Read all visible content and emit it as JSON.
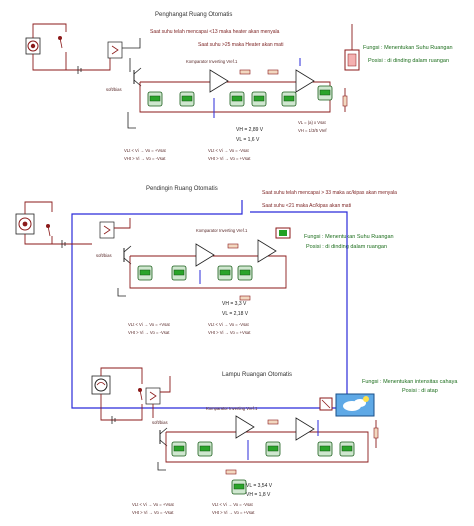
{
  "sections": [
    {
      "title": "Penghangat Ruang Otomatis",
      "notes": [
        "Saat suhu  telah mencapai  <13 maka heater akan menyala",
        "Saat suhu >25 maka Heater akan mati"
      ],
      "function_label": "Fungsi : Menentukan Suhu Ruangan",
      "position_label": "Posisi : di dinding dalam ruangan",
      "comparator_label": "Komparator Inverting Vref.1",
      "relay_label": "soft/bias",
      "readings": [
        "VH = 2,89 V",
        "VL = 1,6 V"
      ],
      "rules_left": [
        "VLt < Vi  →  Vo = +Vsat",
        "VHt > Vi  →  Vo = -Vsat"
      ],
      "rules_right": [
        "VLt < Vi  →  Vo = -Vsat",
        "VHt > Vi  →  Vo = +Vsat"
      ],
      "mini_notes": [
        "VL = (a) x Vsat",
        "VH = 1/3/5 Vref"
      ]
    },
    {
      "title": "Pendingin Ruang Otomatis",
      "notes": [
        "Saat suhu  telah mencapai  > 33 maka ac/kipas akan menyala",
        "Saat suhu <21 maka Ac/kipas akan mati"
      ],
      "function_label": "Fungsi : Menentukan Suhu Ruangan",
      "position_label": "Posisi : di dinding dalam ruangan",
      "comparator_label": "Komparator Inverting Vref.1",
      "relay_label": "soft/bias",
      "readings": [
        "VH = 3,3 V",
        "VL = 2,18 V"
      ],
      "rules_left": [
        "VLt < Vi  →  Vo = +Vsat",
        "VHt > Vi  →  Vo = -Vsat"
      ],
      "rules_right": [
        "VLt < Vi  →  Vo = -Vsat",
        "VHt > Vi  →  Vo = +Vsat"
      ]
    },
    {
      "title": "Lampu Ruangan Otomatis",
      "notes": [],
      "function_label": "Fungsi : Menentukan intensitas cahaya",
      "position_label": "Posisi : di atap",
      "comparator_label": "Komparator Inverting Vref.1",
      "relay_label": "soft/bias",
      "readings": [
        "VL = 3,54 V",
        "VH = 1,8 V"
      ],
      "rules_left": [
        "VLt < Vi  →  Vo = +Vsat",
        "VHt > Vi  →  Vo = -Vsat"
      ],
      "rules_right": [
        "VLt < Vi  →  Vo = -Vsat",
        "VHt > Vi  →  Vo = +Vsat"
      ]
    }
  ],
  "colors": {
    "wire_red": "#8b1a1a",
    "wire_black": "#222222",
    "wire_blue": "#2b2bd9",
    "meter_green": "#2aa42a",
    "function_text": "#1d6e1d"
  },
  "icons": [
    "heater-lamp-icon",
    "fan-icon",
    "lamp-icon",
    "relay-icon",
    "thermometer-sensor-icon",
    "ldr-sky-sensor-icon",
    "voltmeter-icon",
    "opamp-icon"
  ]
}
